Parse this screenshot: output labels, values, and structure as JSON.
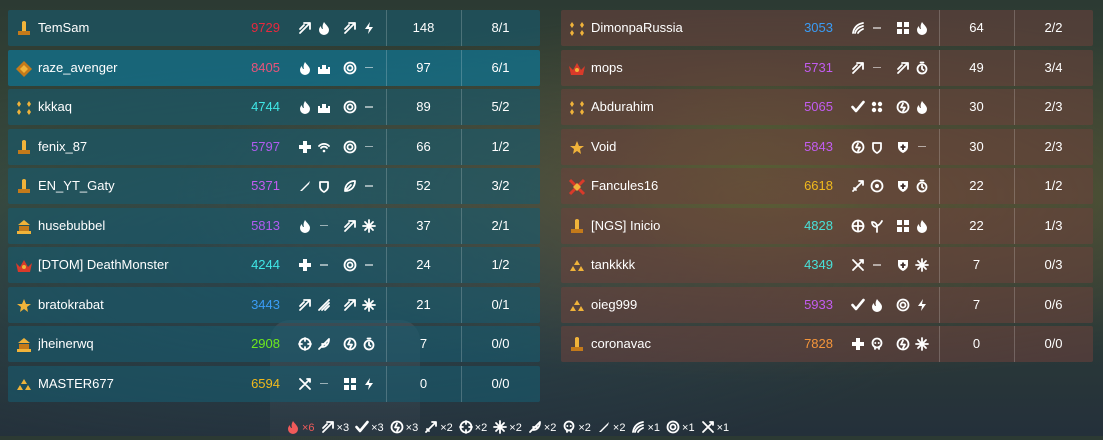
{
  "colors": {
    "red": "#e8283d",
    "pink": "#e8547a",
    "cyan": "#3fe6e6",
    "purple": "#b05cf0",
    "violet": "#c25cf0",
    "blue": "#3a9cf5",
    "green": "#6ee81d",
    "gold": "#f0b91c",
    "orange": "#f5953a",
    "teal": "#48e0d8"
  },
  "team_left": [
    {
      "name": "TemSam",
      "rating": "9729",
      "rating_color": "red",
      "rank_icon": "rank-pillar-icon",
      "perks_a": [
        "arrow-icon",
        "flame-icon"
      ],
      "perks_b": [
        "arrow-icon",
        "bolt-icon"
      ],
      "stat": "148",
      "kd": "8/1",
      "highlight": false
    },
    {
      "name": "raze_avenger",
      "rating": "8405",
      "rating_color": "pink",
      "rank_icon": "rank-diamond-icon",
      "perks_a": [
        "flame-icon",
        "castle-icon"
      ],
      "perks_b": [
        "target-icon",
        "dash"
      ],
      "stat": "97",
      "kd": "6/1",
      "highlight": true
    },
    {
      "name": "kkkaq",
      "rating": "4744",
      "rating_color": "cyan",
      "rank_icon": "rank-gems-icon",
      "perks_a": [
        "flame-icon",
        "castle-icon"
      ],
      "perks_b": [
        "target-icon",
        "dash"
      ],
      "stat": "89",
      "kd": "5/2",
      "highlight": false
    },
    {
      "name": "fenix_87",
      "rating": "5797",
      "rating_color": "purple",
      "rank_icon": "rank-pillar-icon",
      "perks_a": [
        "plus-icon",
        "signal-icon"
      ],
      "perks_b": [
        "target-icon",
        "dash"
      ],
      "stat": "66",
      "kd": "1/2",
      "highlight": false
    },
    {
      "name": "EN_YT_Gaty",
      "rating": "5371",
      "rating_color": "violet",
      "rank_icon": "rank-pillar-icon",
      "perks_a": [
        "blade-icon",
        "shield-wing-icon"
      ],
      "perks_b": [
        "leaf-icon",
        "dash"
      ],
      "stat": "52",
      "kd": "3/2",
      "highlight": false
    },
    {
      "name": "husebubbel",
      "rating": "5813",
      "rating_color": "purple",
      "rank_icon": "rank-temple-icon",
      "perks_a": [
        "flame-icon",
        "dash"
      ],
      "perks_b": [
        "arrow-icon",
        "snowflake-icon"
      ],
      "stat": "37",
      "kd": "2/1",
      "highlight": false
    },
    {
      "name": "[DTOM] DeathMonster",
      "rating": "4244",
      "rating_color": "cyan",
      "rank_icon": "rank-crown-icon",
      "perks_a": [
        "plus-icon",
        "dash"
      ],
      "perks_b": [
        "target-icon",
        "dash"
      ],
      "stat": "24",
      "kd": "1/2",
      "highlight": false
    },
    {
      "name": "bratokrabat",
      "rating": "3443",
      "rating_color": "blue",
      "rank_icon": "rank-star-icon",
      "perks_a": [
        "arrow-icon",
        "streak-icon"
      ],
      "perks_b": [
        "arrow-icon",
        "snowflake-icon"
      ],
      "stat": "21",
      "kd": "0/1",
      "highlight": false
    },
    {
      "name": "jheinerwq",
      "rating": "2908",
      "rating_color": "green",
      "rank_icon": "rank-temple-icon",
      "perks_a": [
        "crosshair-icon",
        "feather-icon"
      ],
      "perks_b": [
        "power-icon",
        "timer-icon"
      ],
      "stat": "7",
      "kd": "0/0",
      "highlight": false
    },
    {
      "name": "MASTER677",
      "rating": "6594",
      "rating_color": "gold",
      "rank_icon": "rank-triad-icon",
      "perks_a": [
        "wrench-icon",
        "dash"
      ],
      "perks_b": [
        "grid-icon",
        "bolt-icon"
      ],
      "stat": "0",
      "kd": "0/0",
      "highlight": false
    }
  ],
  "team_right": [
    {
      "name": "DimonpaRussia",
      "rating": "3053",
      "rating_color": "blue",
      "rank_icon": "rank-gems-icon",
      "perks_a": [
        "wing-icon",
        "dash"
      ],
      "perks_b": [
        "grid-icon",
        "flame-icon"
      ],
      "stat": "64",
      "kd": "2/2"
    },
    {
      "name": "mops",
      "rating": "5731",
      "rating_color": "violet",
      "rank_icon": "rank-crown-icon",
      "perks_a": [
        "arrow-icon",
        "dash"
      ],
      "perks_b": [
        "arrow-icon",
        "timer-icon"
      ],
      "stat": "49",
      "kd": "3/4"
    },
    {
      "name": "Abdurahim",
      "rating": "5065",
      "rating_color": "violet",
      "rank_icon": "rank-gems-icon",
      "perks_a": [
        "check-icon",
        "dots-icon"
      ],
      "perks_b": [
        "power-icon",
        "flame-icon"
      ],
      "stat": "30",
      "kd": "2/3"
    },
    {
      "name": "Void",
      "rating": "5843",
      "rating_color": "violet",
      "rank_icon": "rank-star-icon",
      "perks_a": [
        "power-icon",
        "shield-wing-icon"
      ],
      "perks_b": [
        "shield-plus-icon",
        "dash"
      ],
      "stat": "30",
      "kd": "2/3"
    },
    {
      "name": "Fancules16",
      "rating": "6618",
      "rating_color": "gold",
      "rank_icon": "rank-cross-icon",
      "perks_a": [
        "sword-icon",
        "gear-icon"
      ],
      "perks_b": [
        "shield-plus-icon",
        "timer-icon"
      ],
      "stat": "22",
      "kd": "1/2"
    },
    {
      "name": "[NGS] Inicio",
      "rating": "4828",
      "rating_color": "teal",
      "rank_icon": "rank-pillar-icon",
      "perks_a": [
        "wheel-icon",
        "sprout-icon"
      ],
      "perks_b": [
        "grid-icon",
        "flame-icon"
      ],
      "stat": "22",
      "kd": "1/3"
    },
    {
      "name": "tankkkk",
      "rating": "4349",
      "rating_color": "teal",
      "rank_icon": "rank-triad-icon",
      "perks_a": [
        "wrench-icon",
        "dash"
      ],
      "perks_b": [
        "shield-plus-icon",
        "snowflake-icon"
      ],
      "stat": "7",
      "kd": "0/3"
    },
    {
      "name": "oieg999",
      "rating": "5933",
      "rating_color": "violet",
      "rank_icon": "rank-triad-icon",
      "perks_a": [
        "check-icon",
        "flame-icon"
      ],
      "perks_b": [
        "target-icon",
        "bolt-icon"
      ],
      "stat": "7",
      "kd": "0/6"
    },
    {
      "name": "coronavac",
      "rating": "7828",
      "rating_color": "orange",
      "rank_icon": "rank-pillar-icon",
      "perks_a": [
        "plus-icon",
        "skull-icon"
      ],
      "perks_b": [
        "power-icon",
        "snowflake-icon"
      ],
      "stat": "0",
      "kd": "0/0"
    }
  ],
  "footer": [
    {
      "icon": "flame-icon",
      "count": "×6",
      "color": "#f05a5a"
    },
    {
      "icon": "arrow-icon",
      "count": "×3",
      "color": "#ffffff"
    },
    {
      "icon": "check-icon",
      "count": "×3",
      "color": "#ffffff"
    },
    {
      "icon": "power-icon",
      "count": "×3",
      "color": "#ffffff"
    },
    {
      "icon": "sword-icon",
      "count": "×2",
      "color": "#ffffff"
    },
    {
      "icon": "crosshair-icon",
      "count": "×2",
      "color": "#ffffff"
    },
    {
      "icon": "snowflake-icon",
      "count": "×2",
      "color": "#ffffff"
    },
    {
      "icon": "feather-icon",
      "count": "×2",
      "color": "#ffffff"
    },
    {
      "icon": "skull-icon",
      "count": "×2",
      "color": "#ffffff"
    },
    {
      "icon": "blade-icon",
      "count": "×2",
      "color": "#ffffff"
    },
    {
      "icon": "wing-icon",
      "count": "×1",
      "color": "#ffffff"
    },
    {
      "icon": "target-icon",
      "count": "×1",
      "color": "#ffffff"
    },
    {
      "icon": "wrench-icon",
      "count": "×1",
      "color": "#ffffff"
    }
  ]
}
